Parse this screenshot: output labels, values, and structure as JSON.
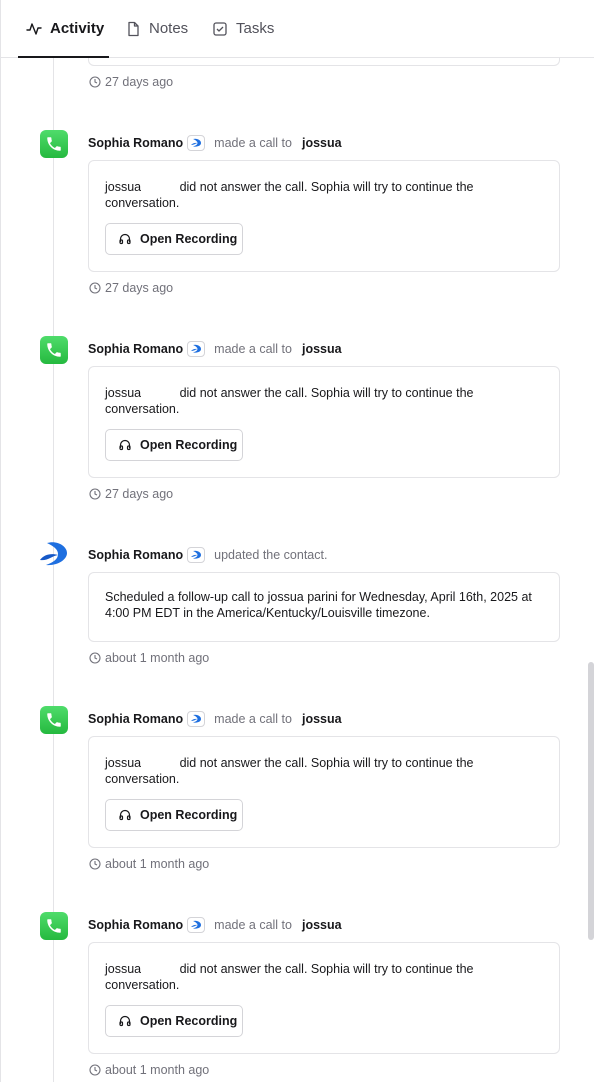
{
  "tabs": [
    {
      "label": "Activity",
      "active": true
    },
    {
      "label": "Notes"
    },
    {
      "label": "Tasks"
    }
  ],
  "timeline": {
    "top_timestamp": "27 days ago",
    "entries": [
      {
        "kind": "call",
        "actor": "Sophia Romano",
        "verb": "made a call to",
        "target": "jossua",
        "text_name": "jossua",
        "text_rest": "did not answer the call. Sophia will try to continue the conversation.",
        "button": "Open Recording",
        "timestamp": "27 days ago"
      },
      {
        "kind": "call",
        "actor": "Sophia Romano",
        "verb": "made a call to",
        "target": "jossua",
        "text_name": "jossua",
        "text_rest": "did not answer the call. Sophia will try to continue the conversation.",
        "button": "Open Recording",
        "timestamp": "27 days ago"
      },
      {
        "kind": "update",
        "actor": "Sophia Romano",
        "verb": "updated the contact.",
        "target": "",
        "text": "Scheduled a follow-up call to jossua parini for Wednesday, April 16th, 2025 at 4:00 PM EDT in the America/Kentucky/Louisville timezone.",
        "timestamp": "about 1 month ago"
      },
      {
        "kind": "call",
        "actor": "Sophia Romano",
        "verb": "made a call to",
        "target": "jossua",
        "text_name": "jossua",
        "text_rest": "did not answer the call. Sophia will try to continue the conversation.",
        "button": "Open Recording",
        "timestamp": "about 1 month ago"
      },
      {
        "kind": "call",
        "actor": "Sophia Romano",
        "verb": "made a call to",
        "target": "jossua",
        "text_name": "jossua",
        "text_rest": "did not answer the call. Sophia will try to continue the conversation.",
        "button": "Open Recording",
        "timestamp": "about 1 month ago"
      }
    ]
  },
  "icons": {
    "phone": "phone-icon",
    "logo": "app-logo-icon",
    "clock": "clock-icon",
    "headphones": "headphones-icon"
  },
  "colors": {
    "phone_green": "#34c759",
    "logo_blue": "#1e6fe0",
    "border": "#e4e4e7",
    "muted": "#71717a"
  }
}
